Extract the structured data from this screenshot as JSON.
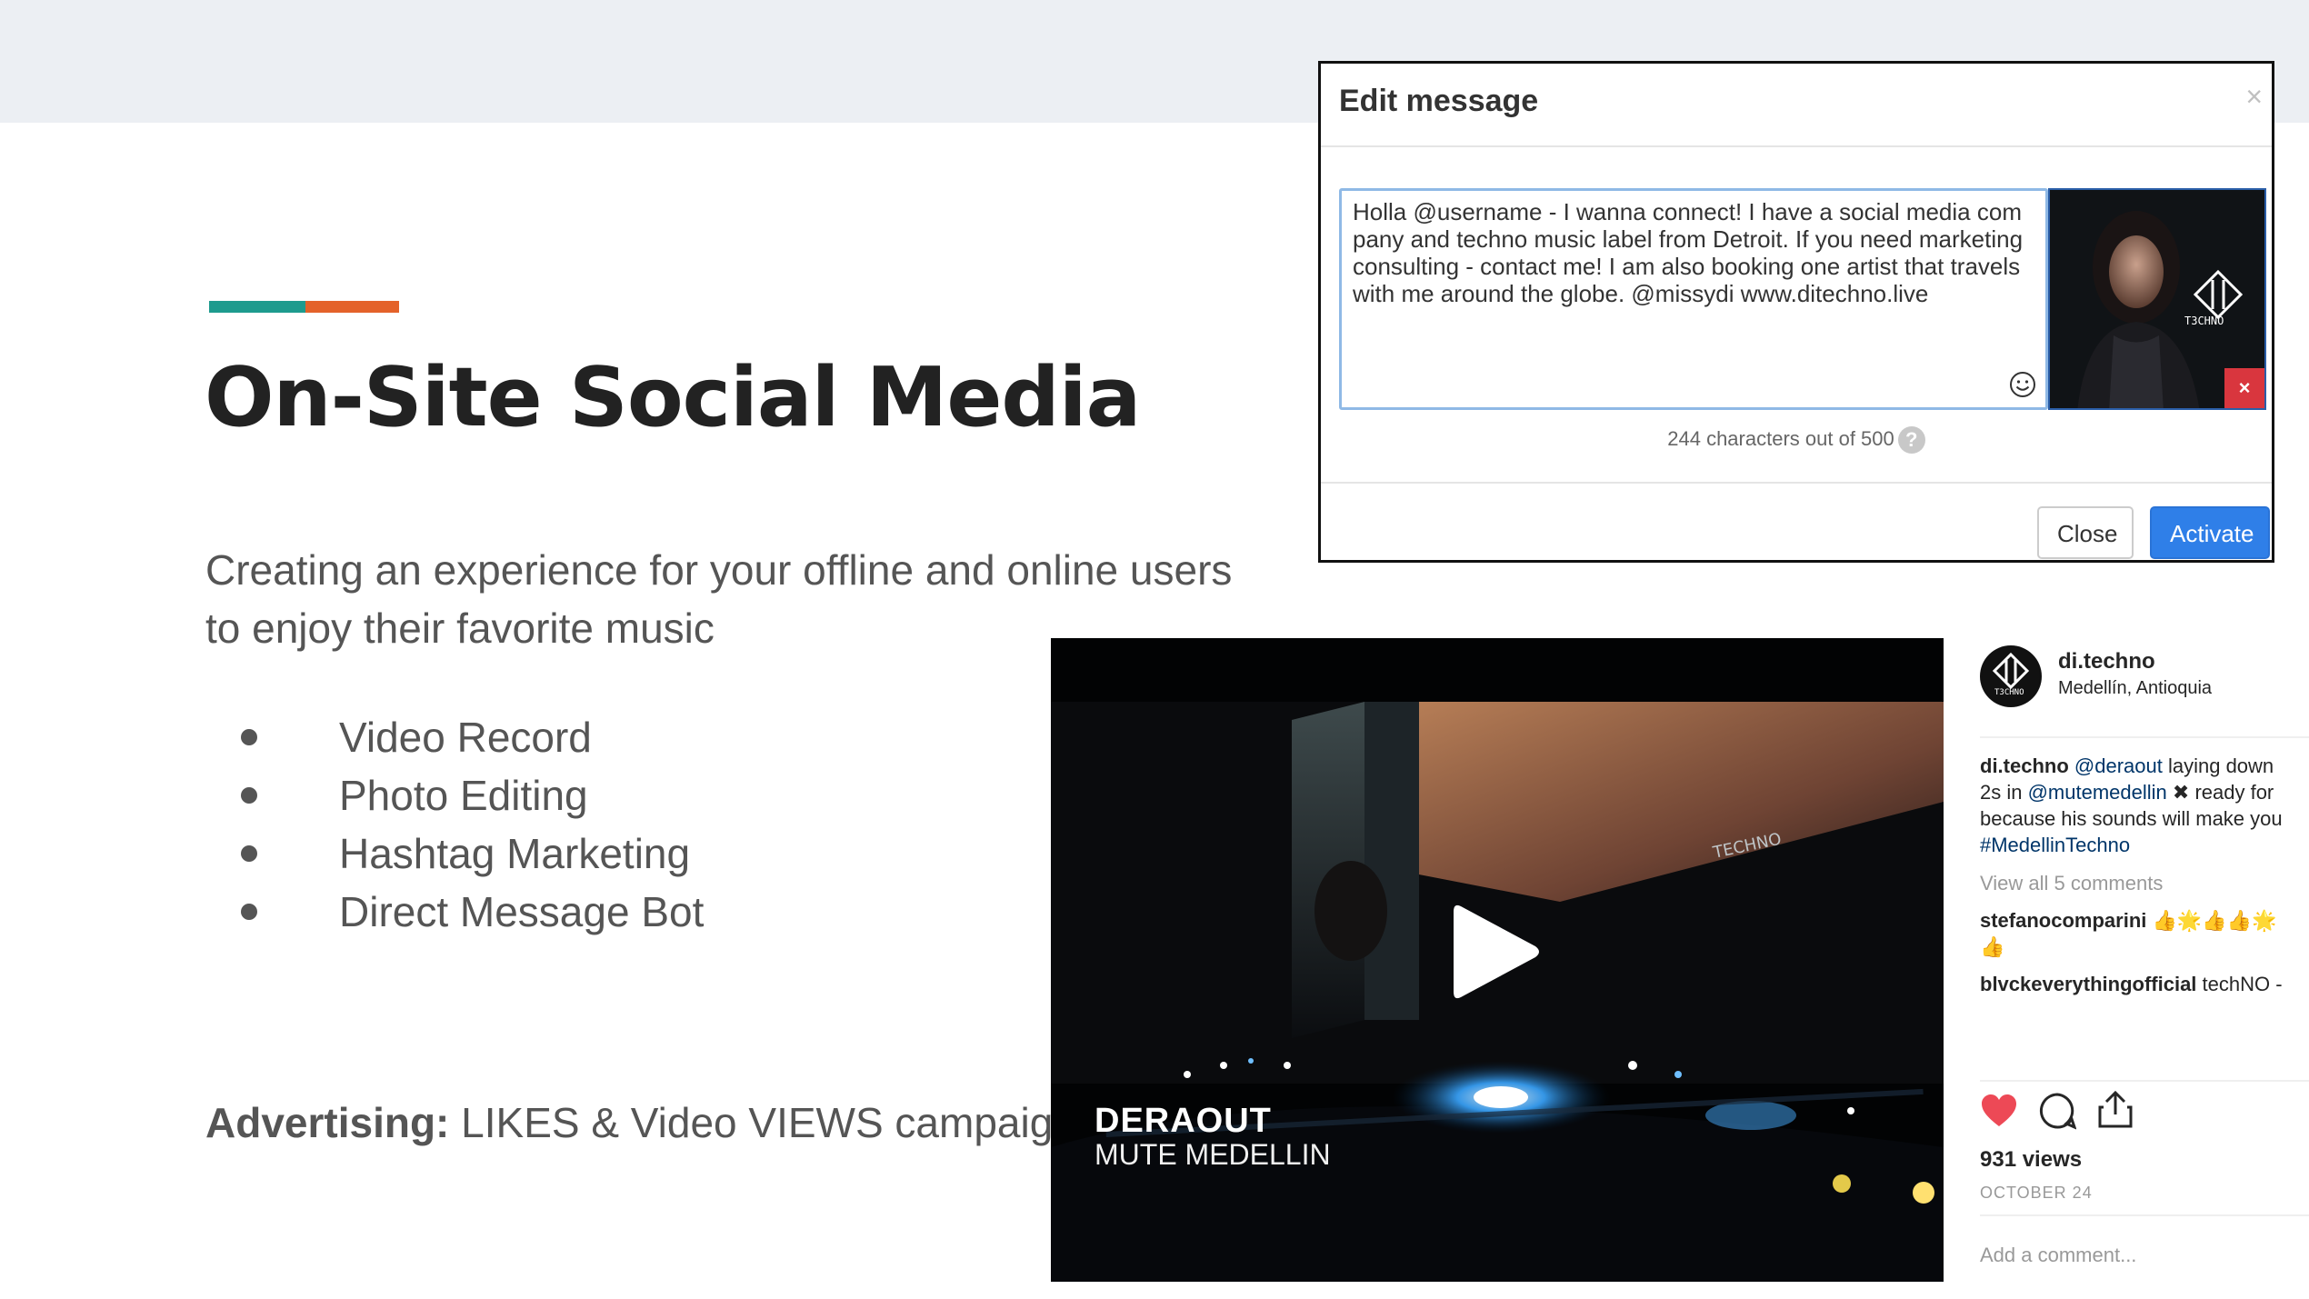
{
  "slide": {
    "title": "On-Site Social Media",
    "subtitle": "Creating an experience for your offline and online users to enjoy their favorite music",
    "bullets": [
      "Video Record",
      "Photo Editing",
      "Hashtag Marketing",
      "Direct Message Bot"
    ],
    "advertising_label": "Advertising:",
    "advertising_text": " LIKES & Video VIEWS campaign",
    "colors": {
      "teal": "#1e9b8e",
      "orange": "#e4622a"
    }
  },
  "modal": {
    "title": "Edit message",
    "close_glyph": "×",
    "message": "Holla @username - I wanna connect! I have a social media company and techno music label from Detroit. If you need marketing consulting - contact me! I am also booking one artist that travels with me around the globe. @missydi  www.ditechno.live",
    "char_count": "244 characters out of 500",
    "help_glyph": "?",
    "thumb_logo_text": "T3CHNO",
    "remove_glyph": "×",
    "close_button": "Close",
    "activate_button": "Activate"
  },
  "video": {
    "title": "DERAOUT",
    "subtitle": "MUTE MEDELLIN",
    "screen_text": "TECHNO"
  },
  "instagram": {
    "username": "di.techno",
    "location": "Medellín, Antioquia",
    "avatar_text": "T3CHNO",
    "caption_user": "di.techno",
    "caption_mention1": "@deraout",
    "caption_part1": " laying down",
    "caption_line2_a": "2s in ",
    "caption_mention2": "@mutemedellin",
    "caption_line2_b": " ✖ ready for",
    "caption_line3": "because his sounds will make you",
    "caption_hashtag": "#MedellinTechno",
    "view_comments": "View all 5 comments",
    "comment1_user": "stefanocomparini",
    "comment1_text": " 👍🌟👍👍🌟",
    "comment1_cont": "👍",
    "comment2_user": "blvckeverythingofficial",
    "comment2_text": " techNO -",
    "views": "931 views",
    "date": "OCTOBER 24",
    "add_comment": "Add a comment..."
  }
}
